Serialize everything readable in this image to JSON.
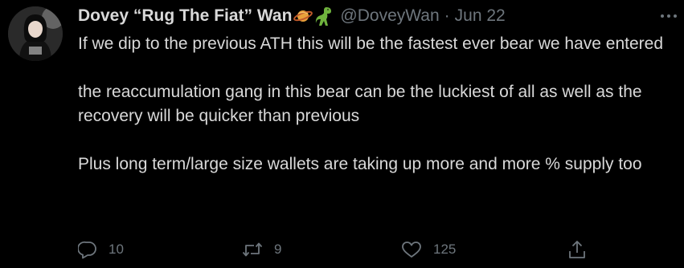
{
  "tweet": {
    "display_name": "Dovey “Rug The Fiat” Wan",
    "name_emojis": [
      "ringed-planet-emoji",
      "dinosaur-emoji"
    ],
    "handle": "@DoveyWan",
    "separator": "·",
    "date": "Jun 22",
    "paragraphs": [
      "If we dip to the previous ATH this will be the fastest ever bear we have entered",
      "the reaccumulation gang in this bear can be the luckiest of all as well as the recovery will be quicker than previous",
      "Plus long term/large size wallets are taking up more and more % supply too"
    ],
    "actions": {
      "reply_count": "10",
      "retweet_count": "9",
      "like_count": "125"
    },
    "icons": {
      "reply": "reply-icon",
      "retweet": "retweet-icon",
      "like": "heart-icon",
      "share": "share-icon",
      "more": "more-icon"
    }
  },
  "colors": {
    "background": "#000000",
    "text": "#d9d9d9",
    "muted": "#6e767d"
  }
}
